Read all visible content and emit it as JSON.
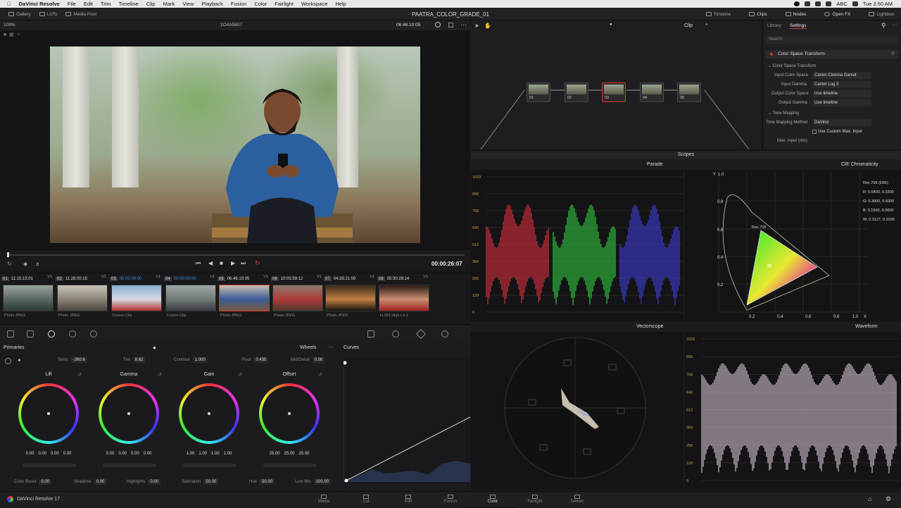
{
  "menubar": {
    "app_name": "DaVinci Resolve",
    "items": [
      "File",
      "Edit",
      "Trim",
      "Timeline",
      "Clip",
      "Mark",
      "View",
      "Playback",
      "Fusion",
      "Color",
      "Fairlight",
      "Workspace",
      "Help"
    ],
    "abc": "ABC",
    "clock": "Tue 2:50 AM"
  },
  "topbar": {
    "gallery": "Gallery",
    "luts": "LUTs",
    "media_pool": "Media Pool",
    "project_title": "PAATRA_COLOR_GRADE_01",
    "timeline": "Timeline",
    "clips": "Clips",
    "nodes": "Nodes",
    "open_fx": "Open FX",
    "lightbox": "Lightbox"
  },
  "viewer": {
    "zoom": "109%",
    "clip_name": "1O4A5607",
    "timecode": "06:46:10:05",
    "duration": "00:00:26:07"
  },
  "clips": [
    {
      "num": "01",
      "tc": "11:15:15:01",
      "track": "V1",
      "codec": "Photo JPEG",
      "colors": [
        "#9aa39e",
        "#5a6860",
        "#2a3a30"
      ]
    },
    {
      "num": "02",
      "tc": "11:28:00:15",
      "track": "V1",
      "codec": "Photo JPEG",
      "colors": [
        "#c9c4b8",
        "#8a8478",
        "#4a463e"
      ]
    },
    {
      "num": "03",
      "tc": "00:00:00:00",
      "track": "V1",
      "codec": "Fusion Clip",
      "colors": [
        "#8ab0d8",
        "#d8d8e0",
        "#b03030"
      ]
    },
    {
      "num": "04",
      "tc": "00:00:00:00",
      "track": "V1",
      "codec": "Fusion Clip",
      "colors": [
        "#a0a8a8",
        "#707878",
        "#3a3a40"
      ]
    },
    {
      "num": "05",
      "tc": "06:46:10:05",
      "track": "V1",
      "codec": "Photo JPEG",
      "colors": [
        "#c8c0b0",
        "#3a5a9a",
        "#7a5a3a"
      ]
    },
    {
      "num": "06",
      "tc": "10:05:59:12",
      "track": "V1",
      "codec": "Photo JPEG",
      "colors": [
        "#8a7a6a",
        "#b03a3a",
        "#4a3a2a"
      ]
    },
    {
      "num": "07",
      "tc": "04:28:21:09",
      "track": "V1",
      "codec": "Photo JPEG",
      "colors": [
        "#3a2a1a",
        "#c08040",
        "#1a1410"
      ]
    },
    {
      "num": "08",
      "tc": "05:30:26:14",
      "track": "V1",
      "codec": "H.264 High L4.1",
      "colors": [
        "#2a1a14",
        "#c89070",
        "#a02020"
      ]
    }
  ],
  "primaries": {
    "title": "Primaries",
    "mode": "Wheels",
    "temp_label": "Temp",
    "temp": "-260.6",
    "tint_label": "Tint",
    "tint": "8.62",
    "contrast_label": "Contrast",
    "contrast": "1.000",
    "pivot_label": "Pivot",
    "pivot": "0.435",
    "middetail_label": "Mid/Detail",
    "middetail": "0.00",
    "wheels": [
      {
        "name": "Lift",
        "values": [
          "0.00",
          "0.00",
          "0.00",
          "0.00"
        ]
      },
      {
        "name": "Gamma",
        "values": [
          "0.00",
          "0.00",
          "0.00",
          "0.00"
        ]
      },
      {
        "name": "Gain",
        "values": [
          "1.00",
          "1.00",
          "1.00",
          "1.00"
        ]
      },
      {
        "name": "Offset",
        "values": [
          "25.00",
          "25.00",
          "25.00"
        ]
      }
    ],
    "colorboost_label": "Color Boost",
    "colorboost": "0.00",
    "shadows_label": "Shadows",
    "shadows": "0.00",
    "highlights_label": "Highlights",
    "highlights": "0.00",
    "saturation_label": "Saturation",
    "saturation": "50.00",
    "hue_label": "Hue",
    "hue": "50.00",
    "lummix_label": "Lum Mix",
    "lummix": "100.00"
  },
  "curves": {
    "title": "Curves"
  },
  "node_editor": {
    "clip_label": "Clip",
    "nodes": [
      {
        "label": "01"
      },
      {
        "label": "02"
      },
      {
        "label": "03"
      },
      {
        "label": "04"
      },
      {
        "label": "05"
      }
    ]
  },
  "settings": {
    "tab_library": "Library",
    "tab_settings": "Settings",
    "search": "Search",
    "effect": "Color Space Transform",
    "section1": "Color Space Transform",
    "input_cs_label": "Input Color Space",
    "input_cs": "Canon Cinema Gamut",
    "input_gamma_label": "Input Gamma",
    "input_gamma": "Canon Log 3",
    "output_cs_label": "Output Color Space",
    "output_cs": "Use timeline",
    "output_gamma_label": "Output Gamma",
    "output_gamma": "Use timeline",
    "section2": "Tone Mapping",
    "tm_method_label": "Tone Mapping Method",
    "tm_method": "DaVinci",
    "custom_max": "Use Custom Max. Input",
    "max_input_label": "Max. Input (nits)"
  },
  "scopes": {
    "title": "Scopes",
    "parade": "Parade",
    "cie": "CIE Chromaticity",
    "vectorscope": "Vectorscope",
    "waveform": "Waveform",
    "levels": [
      "1023",
      "896",
      "768",
      "640",
      "512",
      "384",
      "256",
      "128",
      "0"
    ],
    "cie_info": [
      "Rec.709 (D65)",
      "R: 0.6400, 0.3300",
      "G: 0.3000, 0.6000",
      "B: 0.1500, 0.0600",
      "W: 0.3127, 0.3290"
    ],
    "cie_y_label": "Y",
    "cie_x_label": "X",
    "cie_yticks": [
      "1.0",
      "0.8",
      "0.6",
      "0.4",
      "0.2"
    ],
    "cie_xticks": [
      "0.2",
      "0.4",
      "0.6",
      "0.8",
      "1.0"
    ],
    "rec709": "Rec.709"
  },
  "pages": [
    {
      "label": "Media"
    },
    {
      "label": "Cut"
    },
    {
      "label": "Edit"
    },
    {
      "label": "Fusion"
    },
    {
      "label": "Color"
    },
    {
      "label": "Fairlight"
    },
    {
      "label": "Deliver"
    }
  ],
  "footer": {
    "app_version": "DaVinci Resolve 17"
  },
  "colors": {
    "accent": "#d33a2f",
    "selected_tc": "#3a8fd8"
  }
}
